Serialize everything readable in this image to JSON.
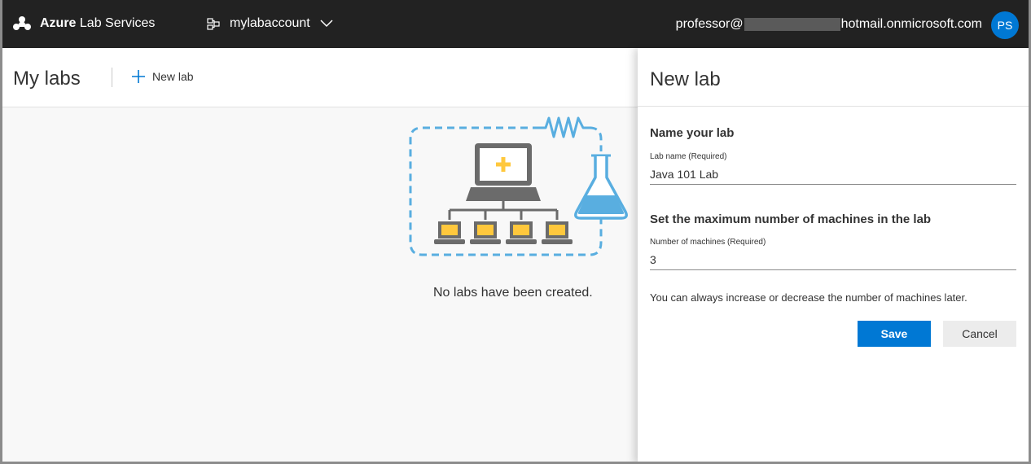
{
  "app": {
    "title_strong": "Azure",
    "title_rest": " Lab Services",
    "account_name": "mylabaccount",
    "user_prefix": "professor@",
    "user_suffix": "hotmail.onmicrosoft.com",
    "avatar_initials": "PS"
  },
  "page": {
    "title": "My labs",
    "new_lab_label": "New lab",
    "empty_message": "No labs have been created."
  },
  "panel": {
    "title": "New lab",
    "name_section": "Name your lab",
    "lab_name_label": "Lab name (Required)",
    "lab_name_value": "Java 101 Lab",
    "machines_section": "Set the maximum number of machines in the lab",
    "machines_label": "Number of machines (Required)",
    "machines_value": "3",
    "hint": "You can always increase or decrease the number of machines later.",
    "save_label": "Save",
    "cancel_label": "Cancel"
  },
  "colors": {
    "topbar": "#222222",
    "accent": "#0078d4",
    "illustration_blue": "#59aee0",
    "illustration_yellow": "#ffc83d",
    "illustration_gray": "#6b6b6b"
  },
  "icons": {
    "brand": "azure-lab-services-icon",
    "account": "lab-account-icon",
    "account_dropdown": "chevron-down-icon",
    "new_lab": "plus-icon",
    "empty_illustration": "lab-network-illustration"
  }
}
